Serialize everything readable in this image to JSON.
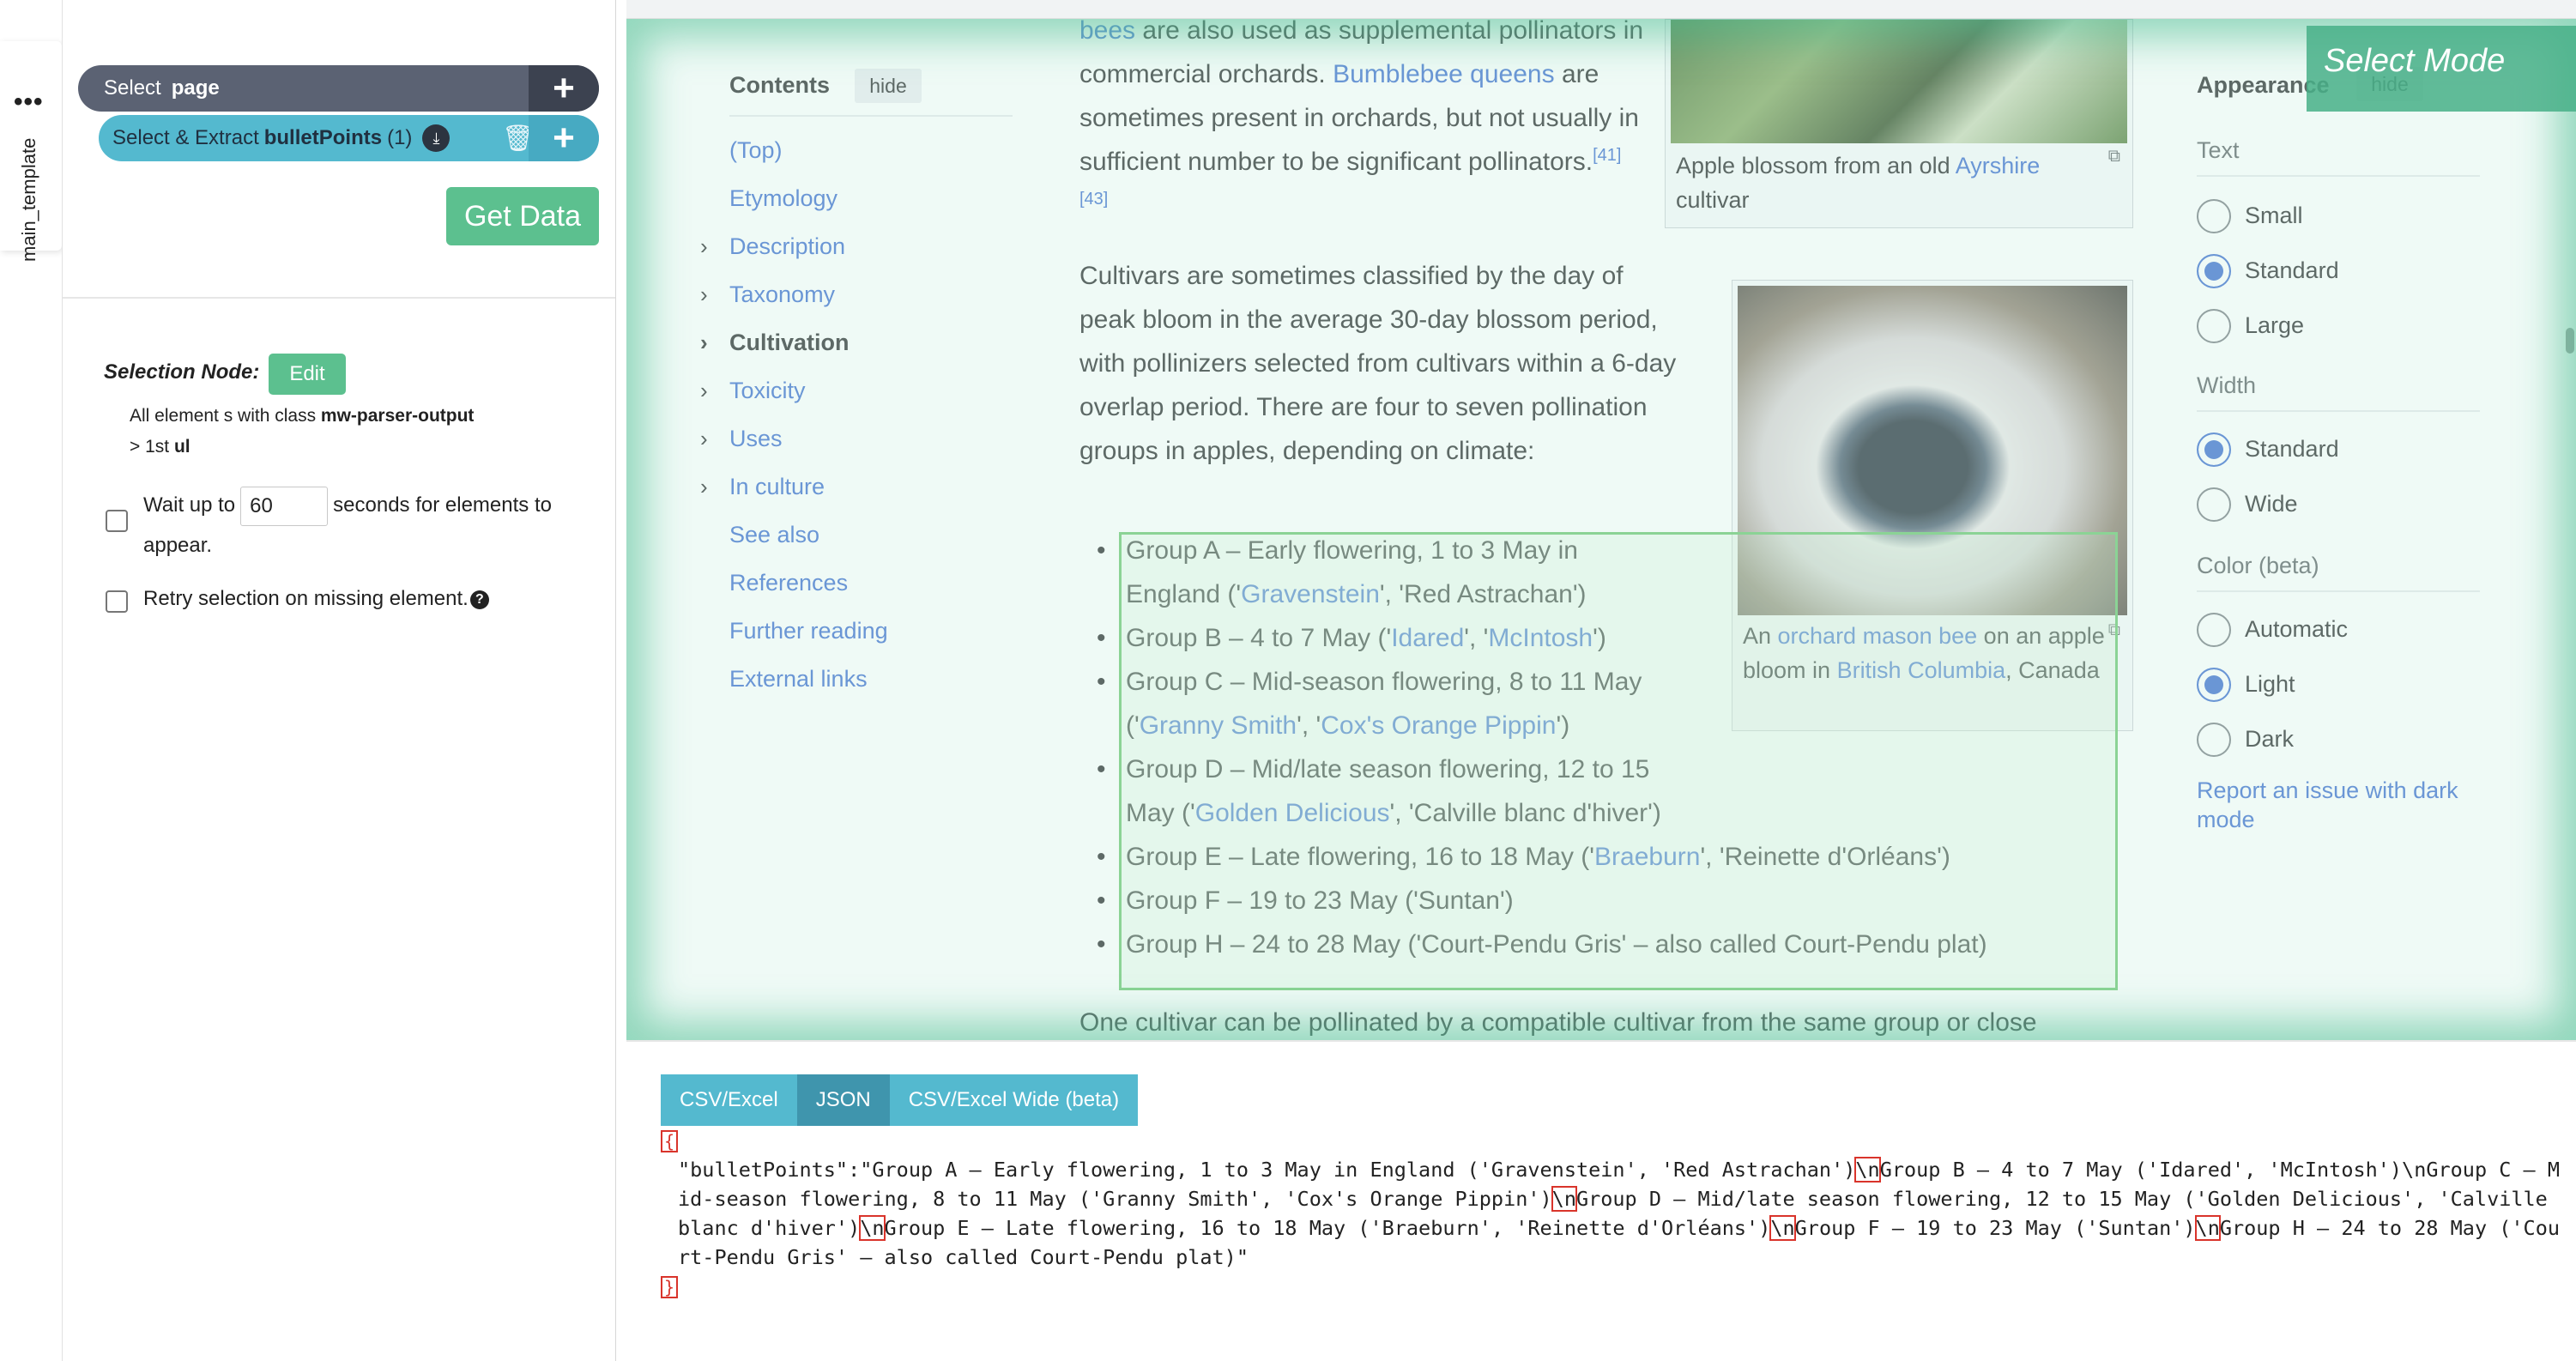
{
  "extension": {
    "tab_label": "main_template",
    "menu_dots": "•••",
    "commands": {
      "page": {
        "action": "Select",
        "target": "page",
        "plus": "+"
      },
      "extract": {
        "action": "Select & Extract",
        "target": "bulletPoints",
        "count": "(1)",
        "plus": "+"
      }
    },
    "get_data_label": "Get Data",
    "selection_node": {
      "label": "Selection Node:",
      "edit_label": "Edit",
      "desc_prefix": "All element s with class ",
      "desc_class": "mw-parser-output",
      "desc_mid": "> 1st ",
      "desc_tag": "ul"
    },
    "wait": {
      "prefix": "Wait up to",
      "value": "60",
      "suffix": "seconds for elements to appear."
    },
    "retry_label": "Retry selection on missing element.",
    "help_icon": "?"
  },
  "page": {
    "select_mode": "Select Mode",
    "contents": {
      "title": "Contents",
      "hide": "hide",
      "items": [
        {
          "label": "(Top)",
          "chevron": false,
          "bold": false
        },
        {
          "label": "Etymology",
          "chevron": false,
          "bold": false
        },
        {
          "label": "Description",
          "chevron": true,
          "bold": false
        },
        {
          "label": "Taxonomy",
          "chevron": true,
          "bold": false
        },
        {
          "label": "Cultivation",
          "chevron": true,
          "bold": true
        },
        {
          "label": "Toxicity",
          "chevron": true,
          "bold": false
        },
        {
          "label": "Uses",
          "chevron": true,
          "bold": false
        },
        {
          "label": "In culture",
          "chevron": true,
          "bold": false
        },
        {
          "label": "See also",
          "chevron": false,
          "bold": false
        },
        {
          "label": "References",
          "chevron": false,
          "bold": false
        },
        {
          "label": "Further reading",
          "chevron": false,
          "bold": false
        },
        {
          "label": "External links",
          "chevron": false,
          "bold": false
        }
      ]
    },
    "article": {
      "p1": {
        "bees": "bees",
        "t1": " are also used as supplemental pollinators in commercial orchards. ",
        "queens": "Bumblebee queens",
        "t2": " are sometimes present in orchards, but not usually in sufficient number to be significant pollinators.",
        "refs": "[41][43]"
      },
      "p2": "Cultivars are sometimes classified by the day of peak bloom in the average 30-day blossom period, with pollinizers selected from cultivars within a 6-day overlap period. There are four to seven pollination groups in apples, depending on climate:",
      "bullets": {
        "a_pre": "Group A – Early flowering, 1 to 3 May in England ('",
        "a_link": "Gravenstein",
        "a_post": "', 'Red Astrachan')",
        "b_pre": "Group B – 4 to 7 May ('",
        "b_link1": "Idared",
        "b_mid": "', '",
        "b_link2": "McIntosh",
        "b_post": "')",
        "c_pre": "Group C – Mid-season flowering, 8 to 11 May ('",
        "c_link1": "Granny Smith",
        "c_mid": "', '",
        "c_link2": "Cox's Orange Pippin",
        "c_post": "')",
        "d_pre": "Group D – Mid/late season flowering, 12 to 15 May ('",
        "d_link": "Golden Delicious",
        "d_post": "', 'Calville blanc d'hiver')",
        "e_pre": "Group E – Late flowering, 16 to 18 May ('",
        "e_link": "Braeburn",
        "e_post": "', 'Reinette d'Orléans')",
        "f": "Group F – 19 to 23 May ('Suntan')",
        "h": "Group H – 24 to 28 May ('Court-Pendu Gris' – also called Court-Pendu plat)"
      },
      "p3": "One cultivar can be pollinated by a compatible cultivar from the same group or close"
    },
    "figure1": {
      "pre": "Apple blossom from an old ",
      "link": "Ayrshire",
      "post": " cultivar"
    },
    "figure2": {
      "pre": "An ",
      "link1": "orchard mason bee",
      "mid": " on an apple bloom in ",
      "link2": "British Columbia",
      "post": ", Canada"
    },
    "appearance": {
      "title": "Appearance",
      "hide": "hide",
      "text_label": "Text",
      "text_options": [
        "Small",
        "Standard",
        "Large"
      ],
      "text_selected": 1,
      "width_label": "Width",
      "width_options": [
        "Standard",
        "Wide"
      ],
      "width_selected": 0,
      "color_label": "Color (beta)",
      "color_options": [
        "Automatic",
        "Light",
        "Dark"
      ],
      "color_selected": 1,
      "report": "Report an issue with dark mode"
    }
  },
  "output": {
    "tabs": [
      "CSV/Excel",
      "JSON",
      "CSV/Excel Wide (beta)"
    ],
    "active_tab": "JSON",
    "open_brace": "{",
    "close_brace": "}",
    "key": "\"bulletPoints\":\"",
    "seg1": "Group A – Early flowering, 1 to 3 May in England ('Gravenstein', 'Red Astrachan')",
    "seg2": "Group B – 4 to 7 May ('Idared', 'McIntosh')\\nGroup C – Mid-season flowering, 8 to 11 May ('Granny Smith', 'Cox's Orange Pippin')",
    "seg3": "Group D – Mid/late season flowering, 12 to 15 May ('Golden Delicious', 'Calville blanc d'hiver')",
    "seg4": "Group E – Late flowering, 16 to 18 May ('Braeburn', 'Reinette d'Orléans')",
    "seg5": "Group F – 19 to 23 May ('Suntan')",
    "seg6": "Group H – 24 to 28 May ('Court-Pendu Gris' – also called Court-Pendu plat)\"",
    "newline": "\\n"
  }
}
